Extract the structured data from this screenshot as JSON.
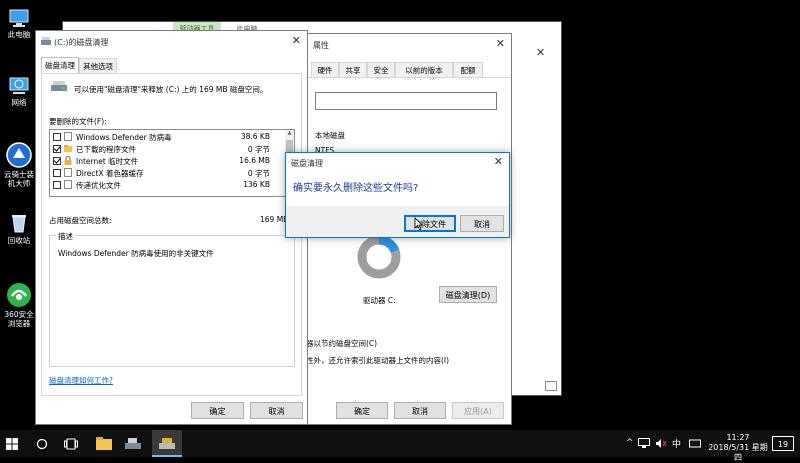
{
  "desktop": {
    "icons": [
      {
        "label": "此电脑"
      },
      {
        "label": "网络"
      },
      {
        "label": "云骑士装机大师"
      },
      {
        "label": "回收站"
      },
      {
        "label": "360安全浏览器"
      }
    ]
  },
  "cleanup": {
    "title": "(C:)的磁盘清理",
    "tabs": [
      "磁盘清理",
      "其他选项"
    ],
    "intro": "可以使用\"磁盘清理\"来释放 (C:) 上的 169 MB 磁盘空间。",
    "list_label": "要删除的文件(F):",
    "files": [
      {
        "name": "Windows Defender 防病毒",
        "size": "38.6 KB",
        "checked": false
      },
      {
        "name": "已下载的程序文件",
        "size": "0 字节",
        "checked": true
      },
      {
        "name": "Internet 临时文件",
        "size": "16.6 MB",
        "checked": true
      },
      {
        "name": "DirectX 着色器缓存",
        "size": "0 字节",
        "checked": false
      },
      {
        "name": "传递优化文件",
        "size": "136 KB",
        "checked": false
      }
    ],
    "total_label": "占用磁盘空间总数:",
    "total_value": "169 MB",
    "desc_label": "描述",
    "desc_text": "Windows Defender 防病毒使用的非关键文件",
    "help_link": "磁盘清理如何工作?",
    "ok": "确定",
    "cancel": "取消"
  },
  "properties": {
    "title": "属性",
    "tabs": [
      "硬件",
      "共享",
      "安全",
      "以前的版本",
      "配额"
    ],
    "disk_type": "本地磁盘",
    "fs": "NTFS",
    "drive_label": "驱动器 C:",
    "cleanup_btn": "磁盘清理(D)",
    "compress": "器以节约磁盘空间(C)",
    "index": "性外，还允许索引此驱动器上文件的内容(I)",
    "ok": "确定",
    "cancel": "取消",
    "apply": "应用(A)"
  },
  "confirm": {
    "title": "磁盘清理",
    "question": "确实要永久删除这些文件吗?",
    "delete": "删除文件",
    "cancel": "取消"
  },
  "back_window": {
    "tab1": "驱动器工具",
    "tab2": "此电脑"
  },
  "taskbar": {
    "time": "11:27",
    "date": "2018/5/31 星期四",
    "ime": "中",
    "badge": "19"
  },
  "colors": {
    "accent": "#0078d7",
    "link": "#0066cc",
    "pie_used": "#2f8fe0",
    "pie_free": "#9e9e9e"
  }
}
